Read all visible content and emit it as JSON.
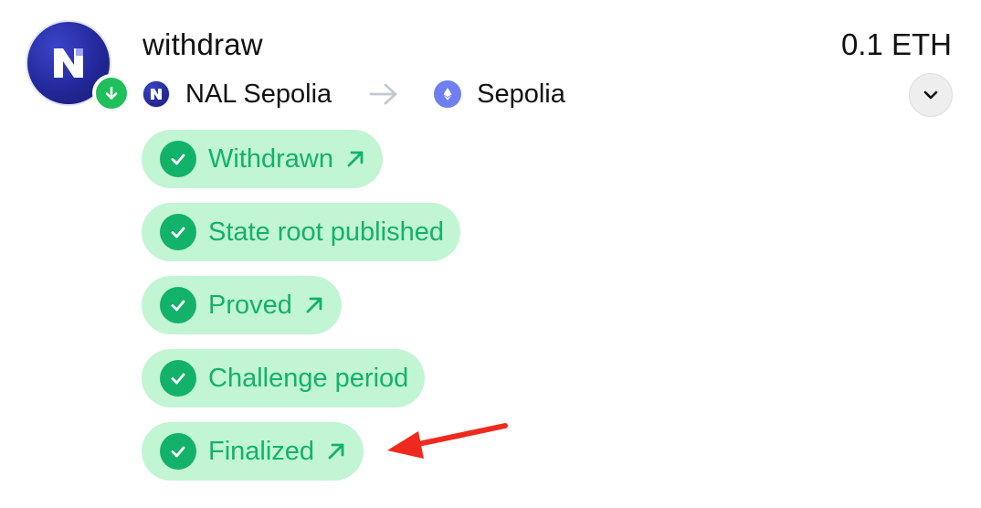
{
  "transaction": {
    "type": "withdraw",
    "amount": "0.1 ETH",
    "type_icon": "arrow-down-icon",
    "avatar_icon": "nal-logo-icon"
  },
  "route": {
    "from": {
      "name": "NAL Sepolia",
      "icon": "nal-logo-icon"
    },
    "to": {
      "name": "Sepolia",
      "icon": "ethereum-icon"
    },
    "separator_icon": "arrow-right-icon"
  },
  "expand_icon": "chevron-down-icon",
  "steps": [
    {
      "label": "Withdrawn",
      "status": "complete",
      "has_link": true
    },
    {
      "label": "State root published",
      "status": "complete",
      "has_link": false
    },
    {
      "label": "Proved",
      "status": "complete",
      "has_link": true
    },
    {
      "label": "Challenge period",
      "status": "complete",
      "has_link": false
    },
    {
      "label": "Finalized",
      "status": "complete",
      "has_link": true
    }
  ],
  "colors": {
    "step_background": "#c2f5d4",
    "step_text": "#12b26a",
    "badge_green": "#1fbf5c",
    "annotation_red": "#f0291e"
  }
}
